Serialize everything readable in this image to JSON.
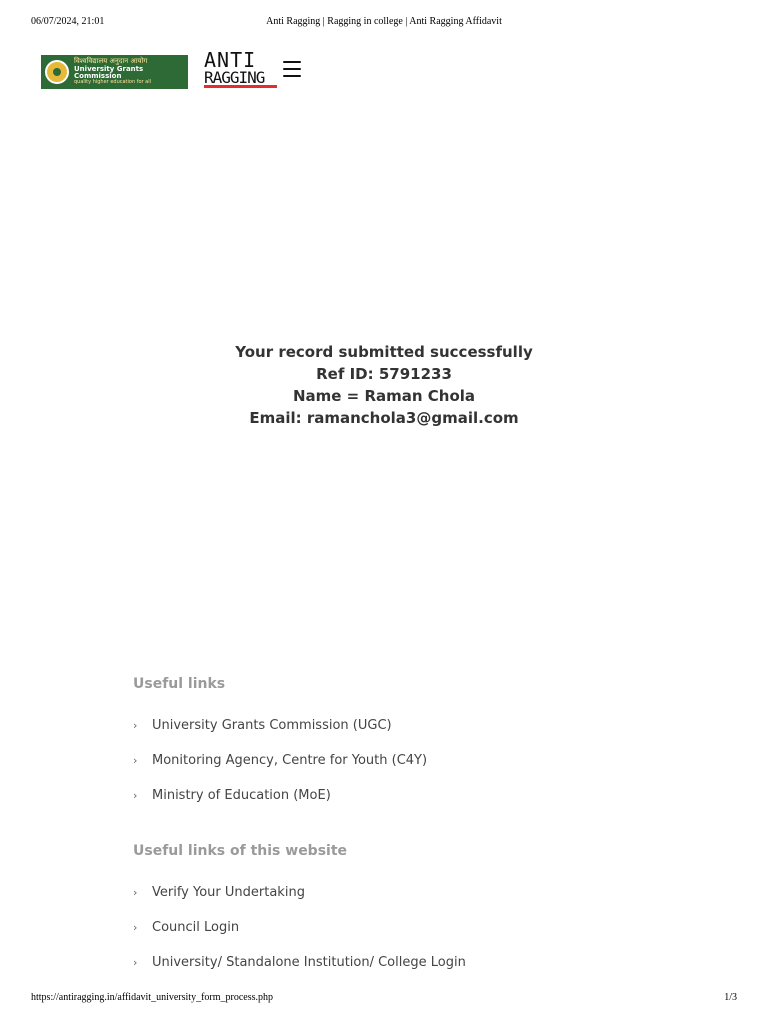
{
  "print": {
    "date": "06/07/2024, 21:01",
    "title": "Anti Ragging | Ragging in college | Anti Ragging Affidavit",
    "url": "https://antiragging.in/affidavit_university_form_process.php",
    "pages": "1/3"
  },
  "header": {
    "ugc_hindi": "विश्वविद्यालय अनुदान आयोग",
    "ugc_name": "University Grants Commission",
    "ugc_tagline": "quality higher education for all",
    "antiragging_top": "ANTI",
    "antiragging_bottom": "RAGGING",
    "menu_icon": "hamburger-menu-icon"
  },
  "result": {
    "line1": "Your record submitted successfully",
    "line2": "Ref ID: 5791233",
    "line3": "Name = Raman Chola",
    "line4": "Email: ramanchola3@gmail.com"
  },
  "useful_links": {
    "title": "Useful links",
    "items": [
      {
        "label": "University Grants Commission (UGC)"
      },
      {
        "label": "Monitoring Agency, Centre for Youth (C4Y)"
      },
      {
        "label": "Ministry of Education (MoE)"
      }
    ]
  },
  "website_links": {
    "title": "Useful links of this website",
    "items": [
      {
        "label": "Verify Your Undertaking"
      },
      {
        "label": "Council Login"
      },
      {
        "label": "University/ Standalone Institution/ College Login"
      }
    ]
  },
  "colors": {
    "ugc_green": "#2d6a35",
    "antiragging_red": "#e32e2e",
    "section_title_gray": "#9a9a9a"
  }
}
